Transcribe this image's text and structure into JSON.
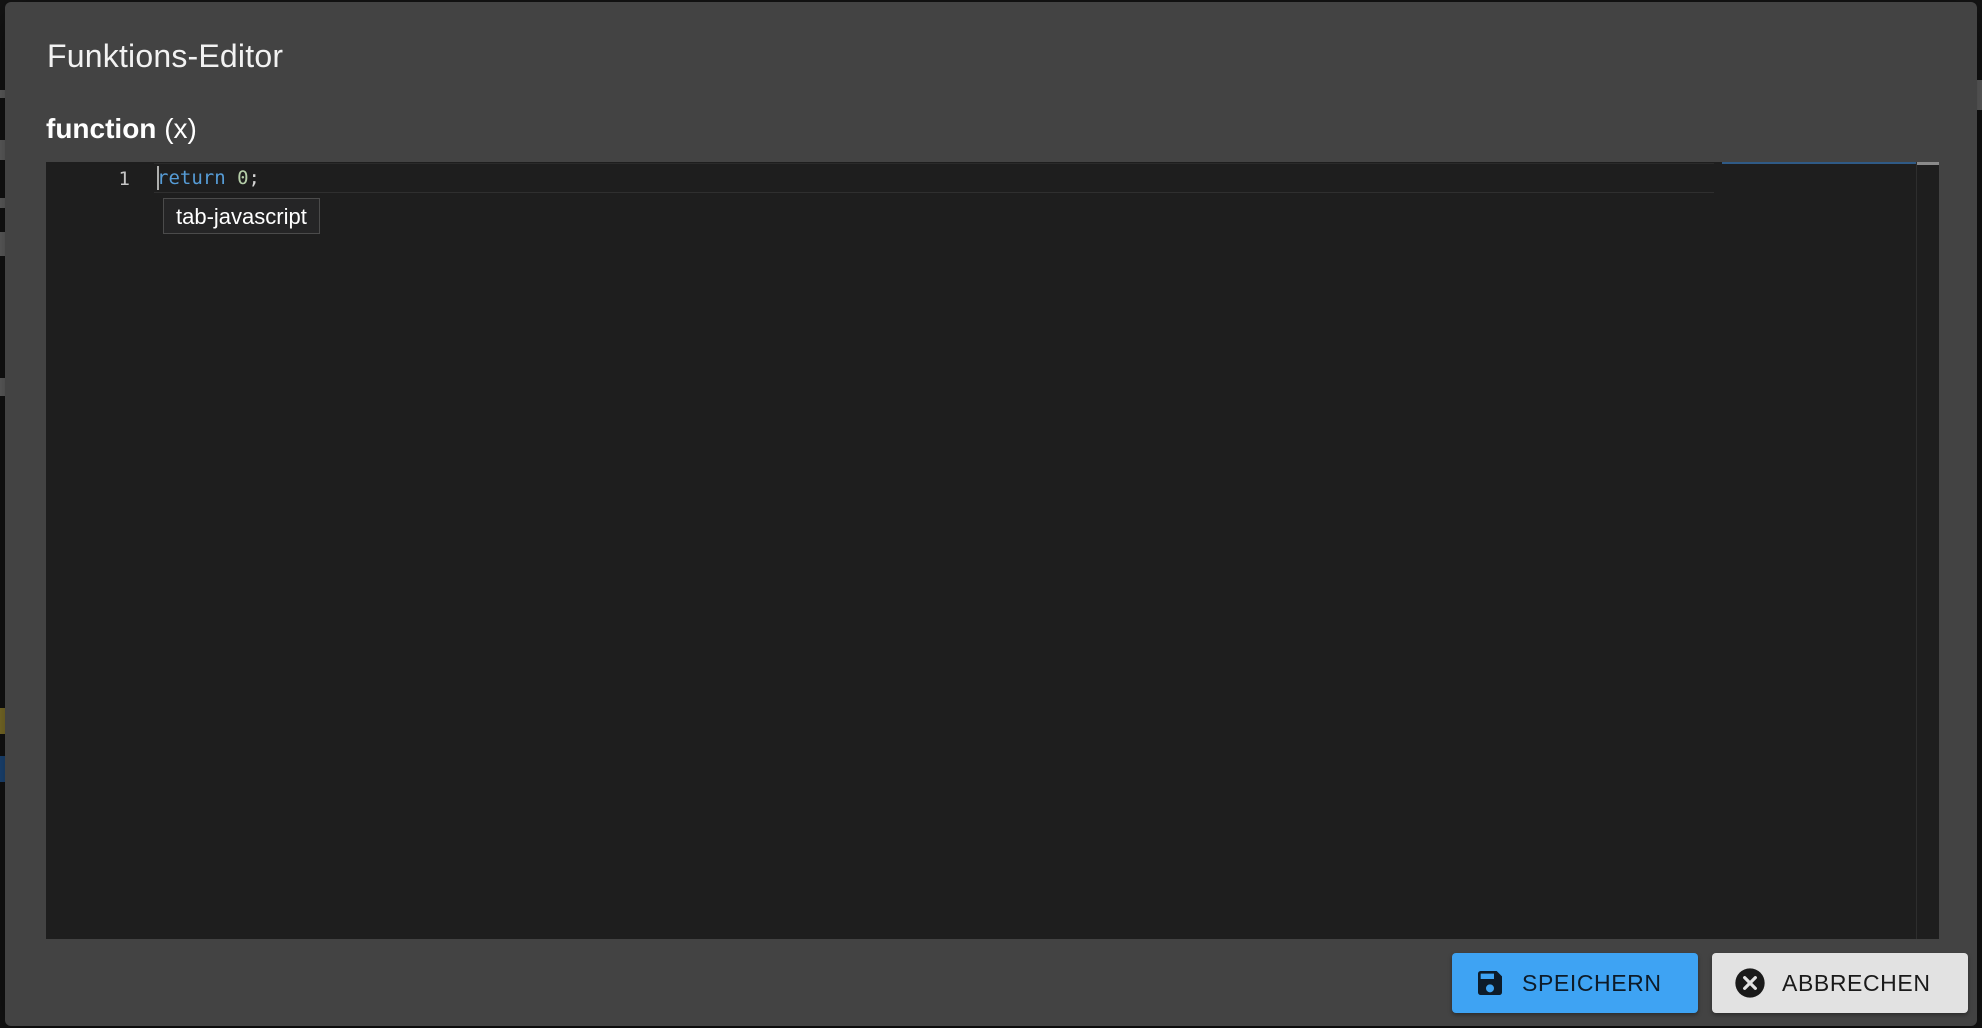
{
  "dialog": {
    "title": "Funktions-Editor",
    "signature_keyword": "function",
    "signature_param": "(x)"
  },
  "editor": {
    "language": "javascript",
    "lines": [
      {
        "number": "1",
        "keyword": "return",
        "number_literal": "0",
        "punct": ";"
      }
    ],
    "suggestion": "tab-javascript"
  },
  "actions": {
    "save_label": "SPEICHERN",
    "cancel_label": "ABBRECHEN",
    "save_icon": "floppy-disk-icon",
    "cancel_icon": "close-circle-icon"
  },
  "colors": {
    "primary": "#3ea3f3",
    "dialog_bg": "#434343",
    "editor_bg": "#1e1e1e",
    "keyword": "#569cd6",
    "number": "#b5cea8"
  }
}
